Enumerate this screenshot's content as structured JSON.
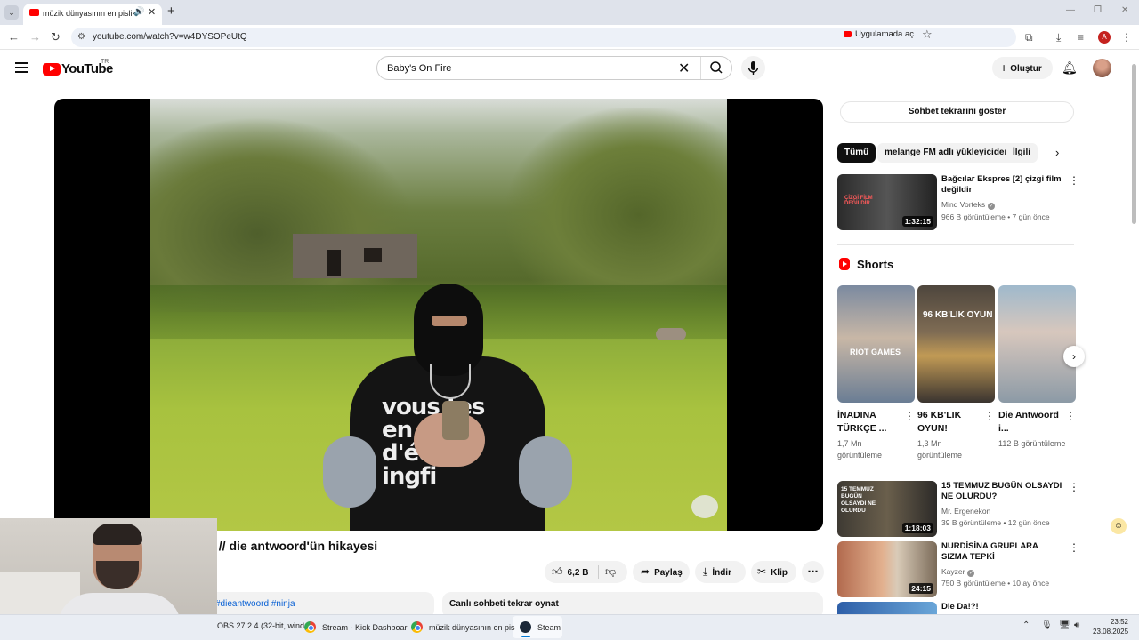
{
  "browser": {
    "tab_title": "müzik dünyasının en pislik adamı",
    "url": "youtube.com/watch?v=w4DYSOPeUtQ",
    "open_in_app": "Uygulamada aç",
    "profile_initial": "A"
  },
  "youtube": {
    "logo_text": "YouTube",
    "country": "TR",
    "search_query": "Baby's On Fire",
    "create_label": "Oluştur"
  },
  "video": {
    "title": "i // die antwoord'ün hikayesi",
    "likes": "6,2 B",
    "share": "Paylaş",
    "download": "İndir",
    "clip": "Klip",
    "shirt_text": "vous tes en trai d'écou ingfi",
    "description_tags": "#dieantwoord #ninja",
    "chat_replay_link": "Canlı sohbeti tekrar oynat"
  },
  "sidebar": {
    "chat_replay_button": "Sohbet tekrarını göster",
    "chips": [
      "Tümü",
      "melange FM adlı yükleyiciden",
      "İlgili"
    ],
    "recommendations_top": [
      {
        "title": "Bağcılar Ekspres [2] çizgi film değildir",
        "channel": "Mind Vorteks",
        "verified": true,
        "meta": "966 B görüntüleme • 7 gün önce",
        "duration": "1:32:15",
        "thumb_text": "ÇİZGİ FİLM DEĞİLDİR"
      }
    ],
    "shorts_heading": "Shorts",
    "shorts": [
      {
        "title": "İNADINA TÜRKÇE ...",
        "views": "1,7 Mn görüntüleme",
        "thumb_text": "RIOT GAMES"
      },
      {
        "title": "96 KB'LIK OYUN!",
        "views": "1,3 Mn görüntüleme",
        "thumb_text": "96 KB'LIK OYUN"
      },
      {
        "title": "Die Antwoord i...",
        "views": "112 B görüntüleme",
        "thumb_text": ""
      }
    ],
    "recommendations_bottom": [
      {
        "title": "15 TEMMUZ BUGÜN OLSAYDI NE OLURDU?",
        "channel": "Mr. Ergenekon",
        "verified": false,
        "meta": "39 B görüntüleme • 12 gün önce",
        "duration": "1:18:03",
        "thumb_text": "15 TEMMUZ BUGÜN OLSAYDI NE OLURDU"
      },
      {
        "title": "NURDİSİNA GRUPLARA SIZMA TEPKİ",
        "channel": "Kayzer",
        "verified": true,
        "meta": "750 B görüntüleme • 10 ay önce",
        "duration": "24:15",
        "thumb_text": ""
      },
      {
        "title": "Die Da!?!",
        "channel": "",
        "verified": false,
        "meta": "",
        "duration": "",
        "thumb_text": ""
      }
    ]
  },
  "taskbar": {
    "items": [
      "OBS 27.2.4 (32-bit, wind",
      "Stream - Kick Dashboar",
      "müzik dünyasının en pis",
      "Steam"
    ],
    "time": "23:52",
    "date": "23.08.2025"
  }
}
